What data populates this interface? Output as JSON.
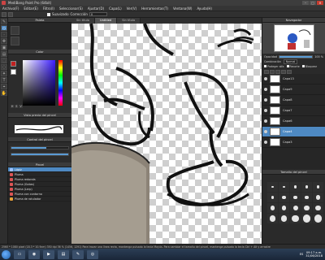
{
  "window": {
    "title": "MediBang Paint Pro (64bit)",
    "buttons": [
      "–",
      "□",
      "×"
    ]
  },
  "menubar": {
    "items": [
      "Archivo(F)",
      "Editar(E)",
      "Filtro(I)",
      "Seleccionar(S)",
      "Ajustar(D)",
      "Capa(L)",
      "Ver(V)",
      "Herramientas(T)",
      "Ventana(W)",
      "Ayuda(H)"
    ]
  },
  "toolbar": {
    "antialias_label": "Suavizado",
    "correction_label": "Corrección",
    "correction_value": "0"
  },
  "tabs": [
    "Sin título",
    "Untitled",
    "Sin título"
  ],
  "left": {
    "palette_title": "Paleta",
    "color_title": "Color",
    "hsv_labels": [
      "H",
      "S",
      "V"
    ],
    "brush_title": "Vista previa del pincel",
    "control_title": "Control del pincel",
    "brush_list_title": "Pincel",
    "brushes": [
      {
        "name": "Lápiz",
        "color": "#9fc3ff",
        "selected": true
      },
      {
        "name": "Pluma",
        "color": "#d55"
      },
      {
        "name": "Pluma redonda",
        "color": "#d55"
      },
      {
        "name": "Pluma (Gotas)",
        "color": "#d55"
      },
      {
        "name": "Pluma (Lerp)",
        "color": "#d55"
      },
      {
        "name": "Pluma con contorno",
        "color": "#d55"
      },
      {
        "name": "Pluma de rotulador",
        "color": "#e8a23a"
      }
    ]
  },
  "right": {
    "navigator_title": "Navegador",
    "opacity_label": "Opacidad",
    "opacity_value": "100 %",
    "blend_label": "Combinación",
    "blend_value": "Normal",
    "checks": [
      "Proteger alfa",
      "Recorte",
      "Bloquear"
    ],
    "layers": [
      {
        "name": "Capa13"
      },
      {
        "name": "Capa9"
      },
      {
        "name": "Capa8"
      },
      {
        "name": "Capa7"
      },
      {
        "name": "Capa6"
      },
      {
        "name": "Capa4",
        "selected": true
      },
      {
        "name": "Capa3"
      }
    ],
    "size_title": "Tamaño del pincel",
    "size_values": [
      "0.7",
      "1",
      "1.5",
      "2",
      "2.5",
      "3",
      "3.5",
      "4",
      "5",
      "6",
      "7",
      "8",
      "9",
      "10",
      "12",
      "15",
      "17",
      "20",
      "25",
      "30"
    ]
  },
  "status": {
    "text": "2560 * 1080 pixel  (18.3 * 10.9cm)  350 dpi  36 %  (1456, 1291)  Para trazar una línea recta, mantenga pulsado la tecla Mayús. Para cambiar el tamaño del pincel, mantenga pulsado la tecla Ctrl + Alt y arrastre"
  },
  "taskbar": {
    "lang": "ES",
    "time": "09:17 a.m.",
    "date": "31/06/2018"
  }
}
